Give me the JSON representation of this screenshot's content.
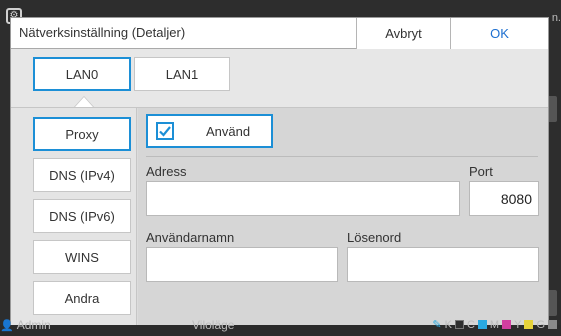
{
  "dialog": {
    "title": "Nätverksinställning (Detaljer)",
    "cancel_label": "Avbryt",
    "ok_label": "OK"
  },
  "tabs": [
    {
      "label": "LAN0",
      "active": true
    },
    {
      "label": "LAN1",
      "active": false
    }
  ],
  "sidebar": {
    "items": [
      {
        "label": "Proxy",
        "active": true
      },
      {
        "label": "DNS (IPv4)"
      },
      {
        "label": "DNS (IPv6)"
      },
      {
        "label": "WINS"
      },
      {
        "label": "Andra"
      }
    ]
  },
  "proxy": {
    "use_label": "Använd",
    "use_checked": true,
    "address_label": "Adress",
    "address_value": "",
    "port_label": "Port",
    "port_value": "8080",
    "username_label": "Användarnamn",
    "username_value": "",
    "password_label": "Lösenord",
    "password_value": ""
  },
  "status": {
    "user": "Admin",
    "mode": "Viloläge",
    "toner_labels": [
      "K",
      "C",
      "M",
      "Y",
      "G"
    ],
    "toner_colors": [
      "#2f2f2f",
      "#2aa9e0",
      "#d23fa0",
      "#e6d23a",
      "#8a8a8a"
    ]
  },
  "background": {
    "corner_text": "n."
  },
  "colors": {
    "accent": "#1c8fd6",
    "ok_text": "#1d6fd0"
  }
}
